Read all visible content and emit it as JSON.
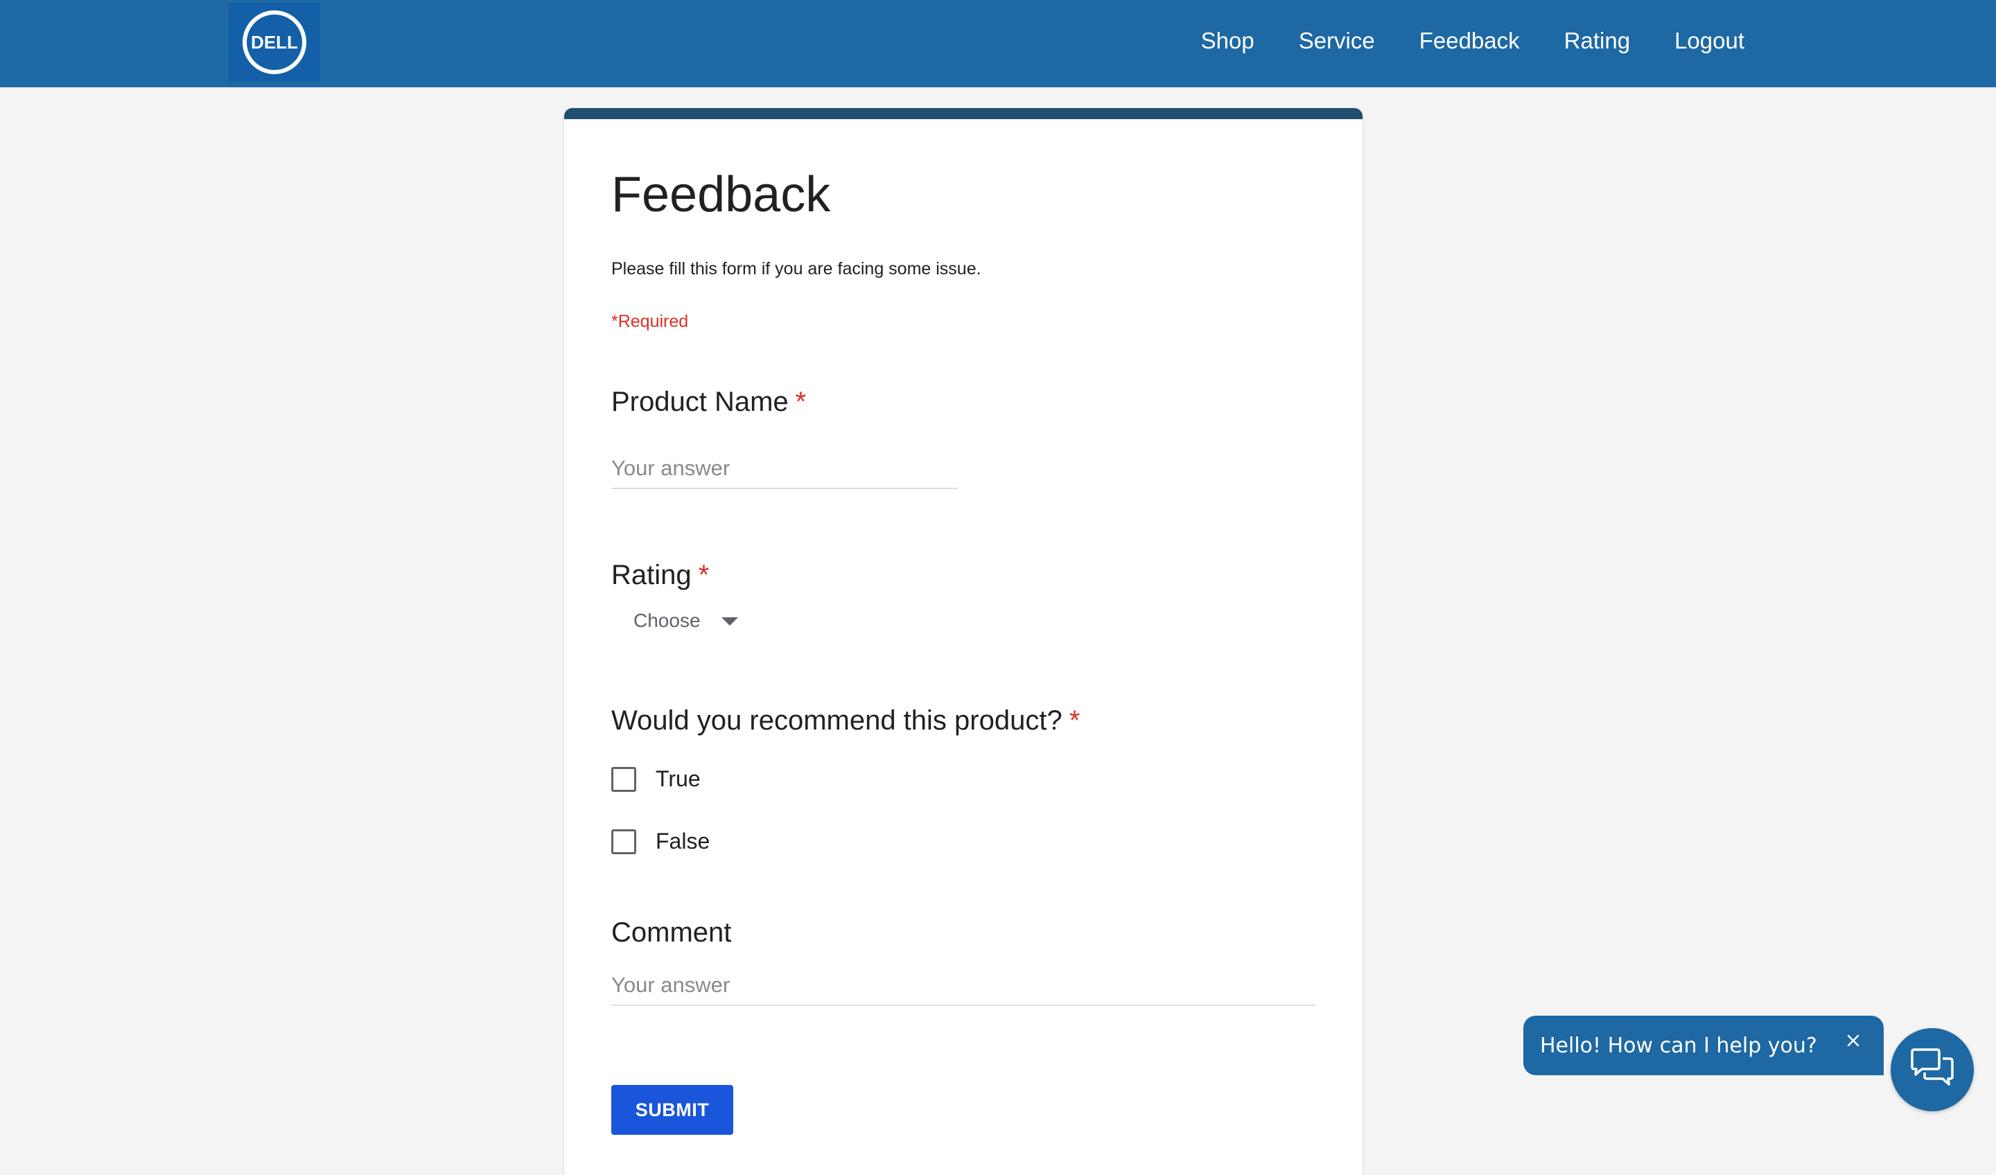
{
  "header": {
    "logo_text": "DELL",
    "nav": [
      "Shop",
      "Service",
      "Feedback",
      "Rating",
      "Logout"
    ]
  },
  "form": {
    "title": "Feedback",
    "description": "Please fill this form if you are facing some issue.",
    "required_note": "*Required",
    "product_name": {
      "label": "Product Name",
      "star": "*",
      "placeholder": "Your answer"
    },
    "rating": {
      "label": "Rating",
      "star": "*",
      "selected": "Choose"
    },
    "recommend": {
      "label": "Would you recommend this product?",
      "star": "*",
      "options": [
        "True",
        "False"
      ]
    },
    "comment": {
      "label": "Comment",
      "placeholder": "Your answer"
    },
    "submit_label": "SUBMIT"
  },
  "chat": {
    "greeting": "Hello! How can I help you?",
    "close_icon": "close-icon",
    "launcher_icon": "chat-bubbles-icon"
  },
  "colors": {
    "header_bg": "#1e68a3",
    "card_accent": "#1f4e6e",
    "required": "#d93025",
    "submit_bg": "#1a56db"
  }
}
